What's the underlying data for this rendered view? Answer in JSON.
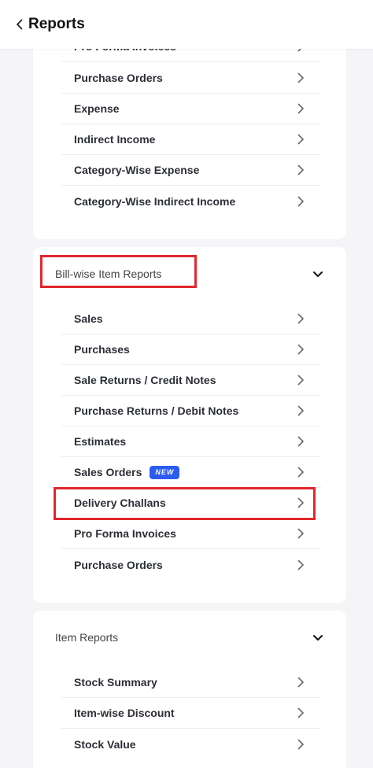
{
  "header": {
    "title": "Reports"
  },
  "card1": {
    "partial_item": "Pro Forma Invoices",
    "items": [
      {
        "label": "Purchase Orders"
      },
      {
        "label": "Expense"
      },
      {
        "label": "Indirect Income"
      },
      {
        "label": "Category-Wise Expense"
      },
      {
        "label": "Category-Wise Indirect Income"
      }
    ]
  },
  "bill_wise": {
    "title": "Bill-wise Item Reports",
    "items": [
      {
        "label": "Sales"
      },
      {
        "label": "Purchases"
      },
      {
        "label": "Sale Returns / Credit Notes"
      },
      {
        "label": "Purchase Returns / Debit Notes"
      },
      {
        "label": "Estimates"
      },
      {
        "label": "Sales Orders",
        "badge": "NEW"
      },
      {
        "label": "Delivery Challans"
      },
      {
        "label": "Pro Forma Invoices"
      },
      {
        "label": "Purchase Orders"
      }
    ]
  },
  "item_reports": {
    "title": "Item Reports",
    "items": [
      {
        "label": "Stock Summary"
      },
      {
        "label": "Item-wise Discount"
      },
      {
        "label": "Stock Value"
      }
    ]
  },
  "colors": {
    "highlight": "#e0282d",
    "badge": "#2a5cf0"
  }
}
